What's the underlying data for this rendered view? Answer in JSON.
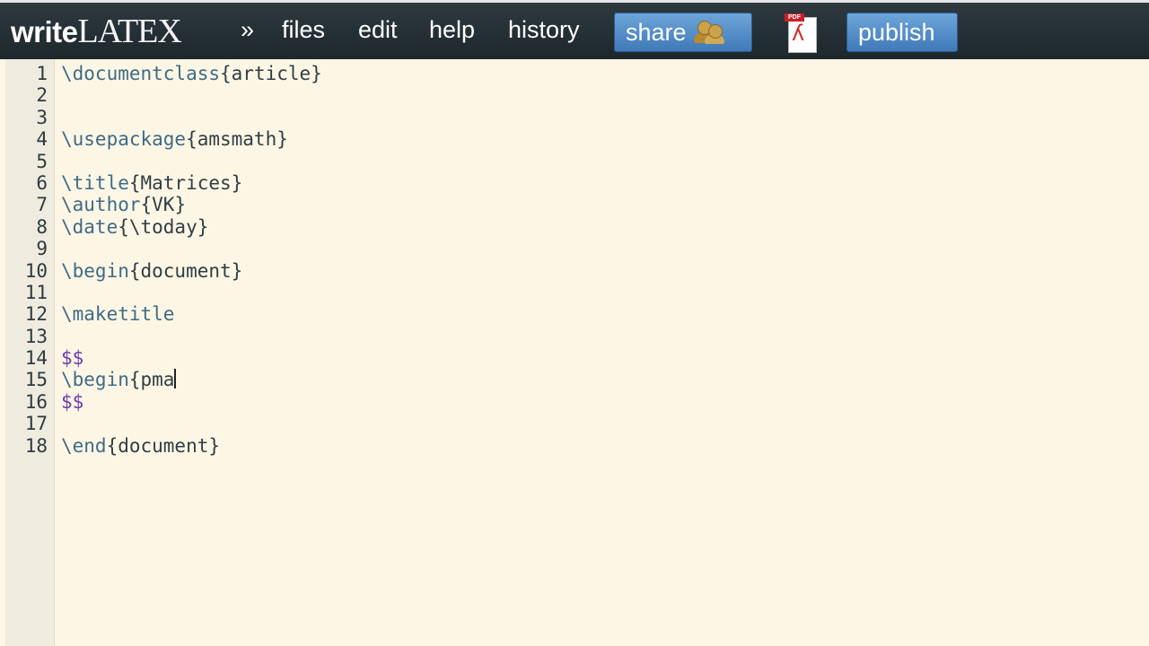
{
  "header": {
    "logo_prefix": "write",
    "logo_suffix": "LATEX",
    "nav": {
      "expand": "»",
      "files": "files",
      "edit": "edit",
      "help": "help",
      "history": "history"
    },
    "share_label": "share",
    "pdf_tag": "PDF",
    "publish_label": "publish"
  },
  "editor": {
    "lines": [
      {
        "n": "1",
        "cmd": "\\documentclass",
        "arg": "{article}"
      },
      {
        "n": "2",
        "cmd": "",
        "arg": ""
      },
      {
        "n": "3",
        "cmd": "",
        "arg": ""
      },
      {
        "n": "4",
        "cmd": "\\usepackage",
        "arg": "{amsmath}"
      },
      {
        "n": "5",
        "cmd": "",
        "arg": ""
      },
      {
        "n": "6",
        "cmd": "\\title",
        "arg": "{Matrices}"
      },
      {
        "n": "7",
        "cmd": "\\author",
        "arg": "{VK}"
      },
      {
        "n": "8",
        "cmd": "\\date",
        "arg": "{\\today}"
      },
      {
        "n": "9",
        "cmd": "",
        "arg": ""
      },
      {
        "n": "10",
        "cmd": "\\begin",
        "arg": "{document}"
      },
      {
        "n": "11",
        "cmd": "",
        "arg": ""
      },
      {
        "n": "12",
        "cmd": "\\maketitle",
        "arg": ""
      },
      {
        "n": "13",
        "cmd": "",
        "arg": ""
      },
      {
        "n": "14",
        "cmd": "",
        "arg": "$$"
      },
      {
        "n": "15",
        "cmd": "\\begin",
        "arg": "{pma"
      },
      {
        "n": "16",
        "cmd": "",
        "arg": "$$"
      },
      {
        "n": "17",
        "cmd": "",
        "arg": ""
      },
      {
        "n": "18",
        "cmd": "\\end",
        "arg": "{document}"
      }
    ]
  }
}
